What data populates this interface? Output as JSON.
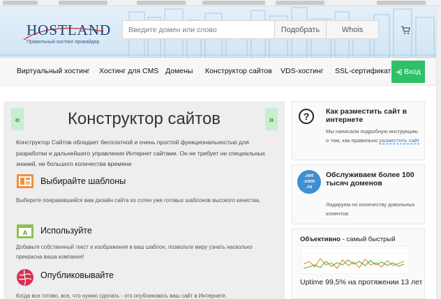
{
  "header": {
    "logo_text": "HOSTLAND",
    "logo_tagline": "Правильный хостинг-провайдер",
    "search_placeholder": "Введите домен или слово",
    "pick_button": "Подобрать",
    "whois_button": "Whois"
  },
  "nav": {
    "items": [
      "Виртуальный хостинг",
      "Хостинг для CMS",
      "Домены",
      "Конструктор сайтов",
      "VDS-хостинг",
      "SSL-сертификаты"
    ],
    "login": "Вход"
  },
  "main": {
    "prev": "«",
    "next": "»",
    "title": "Конструктор сайтов",
    "intro": "Конструктор Сайтов обладает бесплатной и очень простой функциональностью для разработки и дальнейшего управления Интернет сайтами. Он не требует ни специальных знаний, ни большого количества времени",
    "sections": [
      {
        "title": "Выбирайте шаблоны",
        "text": "Выберите понравившийся вам дизайн сайта из сотен уже готовых шаблонов высокого качества."
      },
      {
        "title": "Используйте",
        "text": "Добавьте собственный текст и изображения в ваш шаблон, позвольте миру узнать насколько прекрасна ваша компания!"
      },
      {
        "title": "Опубликовывайте",
        "text": "Когда все готово, все, что нужно сделать - это опубликовать ваш сайт в Интернете."
      }
    ]
  },
  "sidebar": {
    "card1": {
      "title": "Как разместить сайт в интернете",
      "text": "Мы написали подробную инструкцию о том, как правильно",
      "link": "разместить сайт"
    },
    "card2": {
      "icon_text_top": ".net",
      "icon_text_bottom": ".com",
      "icon_text_ru": ".ru",
      "title": "Обслуживаем более 100 тысяч доменов",
      "text": "Лидируем по количеству довольных клиентов"
    },
    "card3": {
      "label_bold": "Объективно",
      "label_rest": " - самый быстрый",
      "uptime": "Uptime 99,5% на протяжении 13 лет"
    }
  },
  "colors": {
    "accent_green": "#2fc067",
    "link_blue": "#2a7fd4",
    "chart_orange": "#e58a1f",
    "chart_green": "#4caf50"
  }
}
